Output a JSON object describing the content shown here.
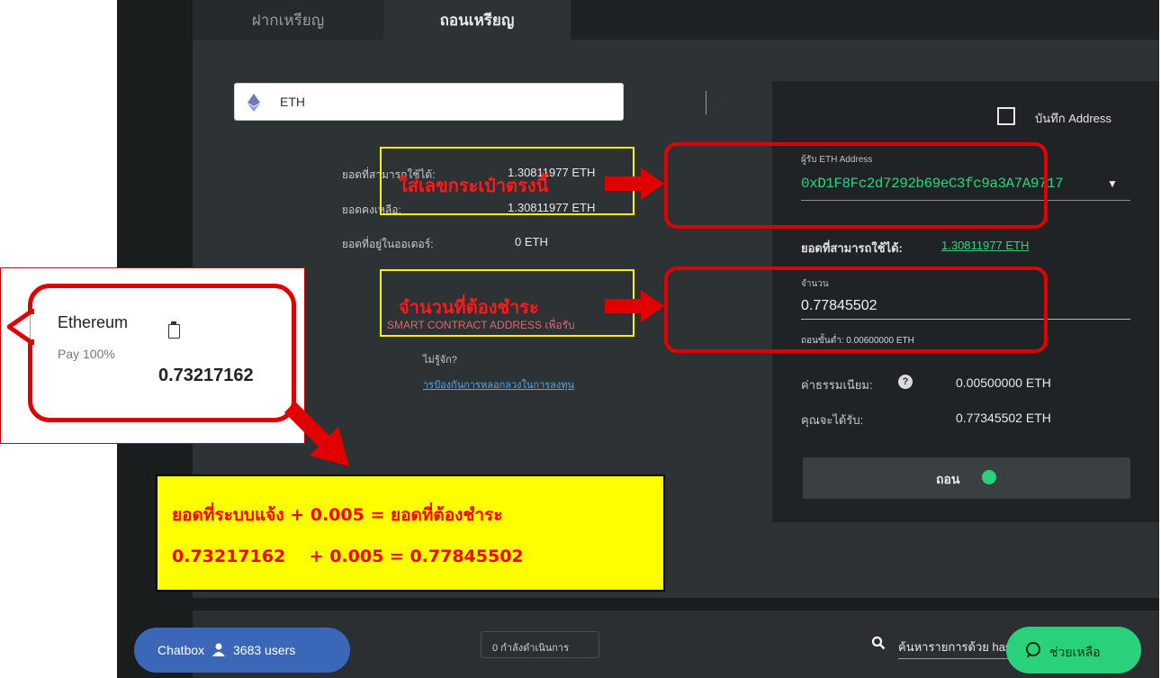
{
  "tabs": {
    "deposit": "ฝากเหรียญ",
    "withdraw": "ถอนเหรียญ"
  },
  "coin_select": {
    "value": "ETH"
  },
  "balances": {
    "available_label": "ยอดที่สามารถใช้ได้:",
    "available_value": "1.30811977 ETH",
    "remaining_label": "ยอดคงเหลือ:",
    "remaining_value": "1.30811977 ETH",
    "in_order_label": "ยอดที่อยู่ในออเดอร์:",
    "in_order_value": "0 ETH"
  },
  "left_notes": {
    "warning": "SMART CONTRACT ADDRESS เพื่อรับ",
    "question": "ไม่รู้จัก?",
    "link": "ารป้องกันการหลอกลวงในการลงทุน"
  },
  "right_panel": {
    "save_address_label": "บันทึก Address",
    "address_field_label": "ผู้รับ ETH Address",
    "address_value": "0xD1F8Fc2d7292b69eC3fc9a3A7A9717",
    "available_label": "ยอดที่สามารถใช้ได้:",
    "available_value": "1.30811977 ETH",
    "amount_label": "จำนวน",
    "amount_value": "0.77845502",
    "minimum_text": "ถอนขั้นต่ำ: 0.00600000 ETH",
    "fee_label": "ค่าธรรมเนียม:",
    "fee_value": "0.00500000 ETH",
    "receive_label": "คุณจะได้รับ:",
    "receive_value": "0.77345502 ETH",
    "withdraw_button": "ถอน"
  },
  "annotations": {
    "address_hint": "ใส่เลขกระเป๋าตรงนี้",
    "amount_hint": "จำนวนที่ต้องชำระ",
    "summary_line1": "ยอดที่ระบบแจ้ง + 0.005 = ยอดที่ต้องชำระ",
    "summary_line2": "0.73217162    + 0.005 = 0.77845502"
  },
  "callout": {
    "title": "Ethereum",
    "subtitle": "Pay 100%",
    "amount": "0.73217162"
  },
  "bottom": {
    "status_text": "0 กำลังดำเนินการ",
    "search_placeholder": "ค้นหารายการด้วย hash",
    "chatbox_label": "Chatbox",
    "chatbox_users": "3683 users",
    "help_label": "ช่วยเหลือ"
  },
  "colors": {
    "accent_green": "#29d27a",
    "highlight_red": "#e00000",
    "highlight_yellow": "#ffff00"
  }
}
